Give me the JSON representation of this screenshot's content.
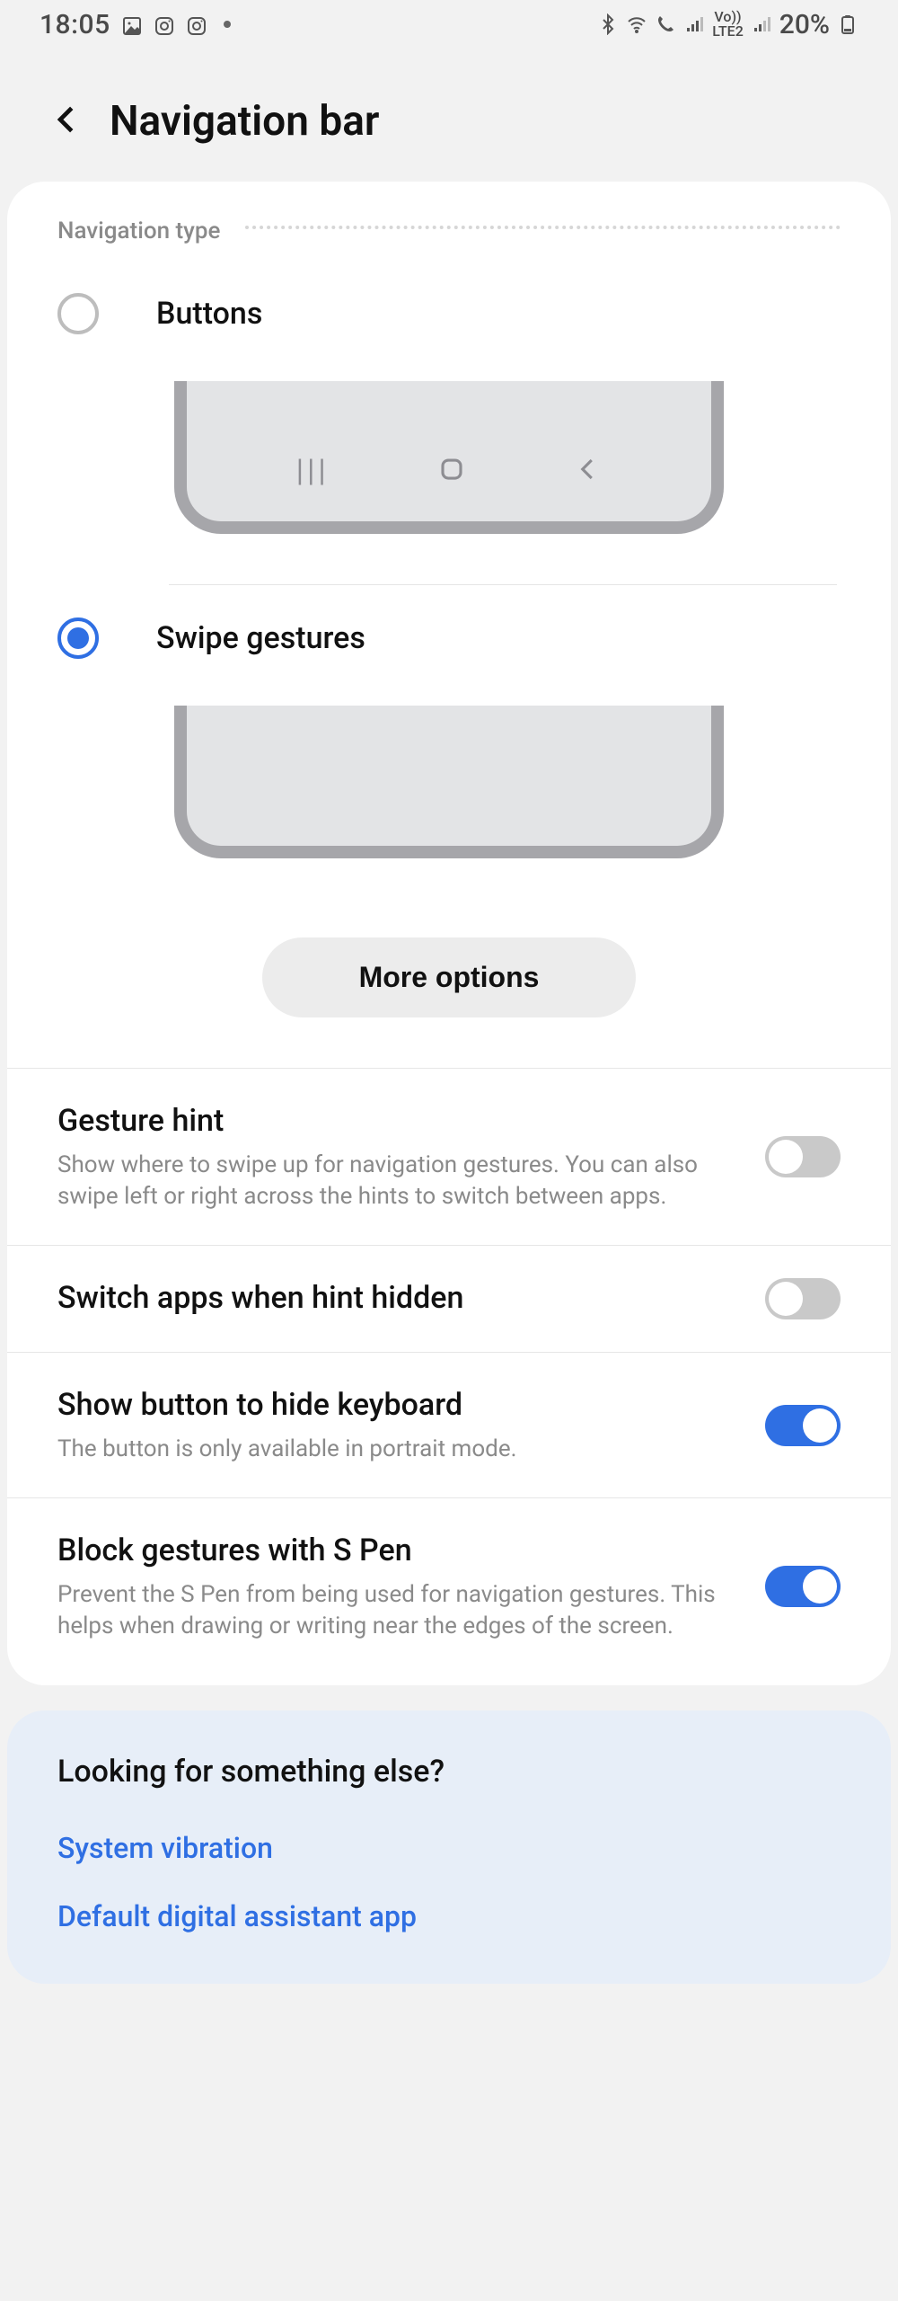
{
  "status": {
    "time": "18:05",
    "battery_pct": "20%"
  },
  "header": {
    "title": "Navigation bar"
  },
  "navtype": {
    "section_label": "Navigation type",
    "options": {
      "buttons": {
        "label": "Buttons",
        "selected": false
      },
      "gestures": {
        "label": "Swipe gestures",
        "selected": true
      }
    },
    "more_options": "More options"
  },
  "settings": {
    "gesture_hint": {
      "title": "Gesture hint",
      "desc": "Show where to swipe up for navigation gestures. You can also swipe left or right across the hints to switch between apps.",
      "on": false
    },
    "switch_apps": {
      "title": "Switch apps when hint hidden",
      "on": false
    },
    "hide_kb_button": {
      "title": "Show button to hide keyboard",
      "desc": "The button is only available in portrait mode.",
      "on": true
    },
    "block_spen": {
      "title": "Block gestures with S Pen",
      "desc": "Prevent the S Pen from being used for navigation gestures. This helps when drawing or writing near the edges of the screen.",
      "on": true
    }
  },
  "footer": {
    "title": "Looking for something else?",
    "links": [
      "System vibration",
      "Default digital assistant app"
    ]
  }
}
